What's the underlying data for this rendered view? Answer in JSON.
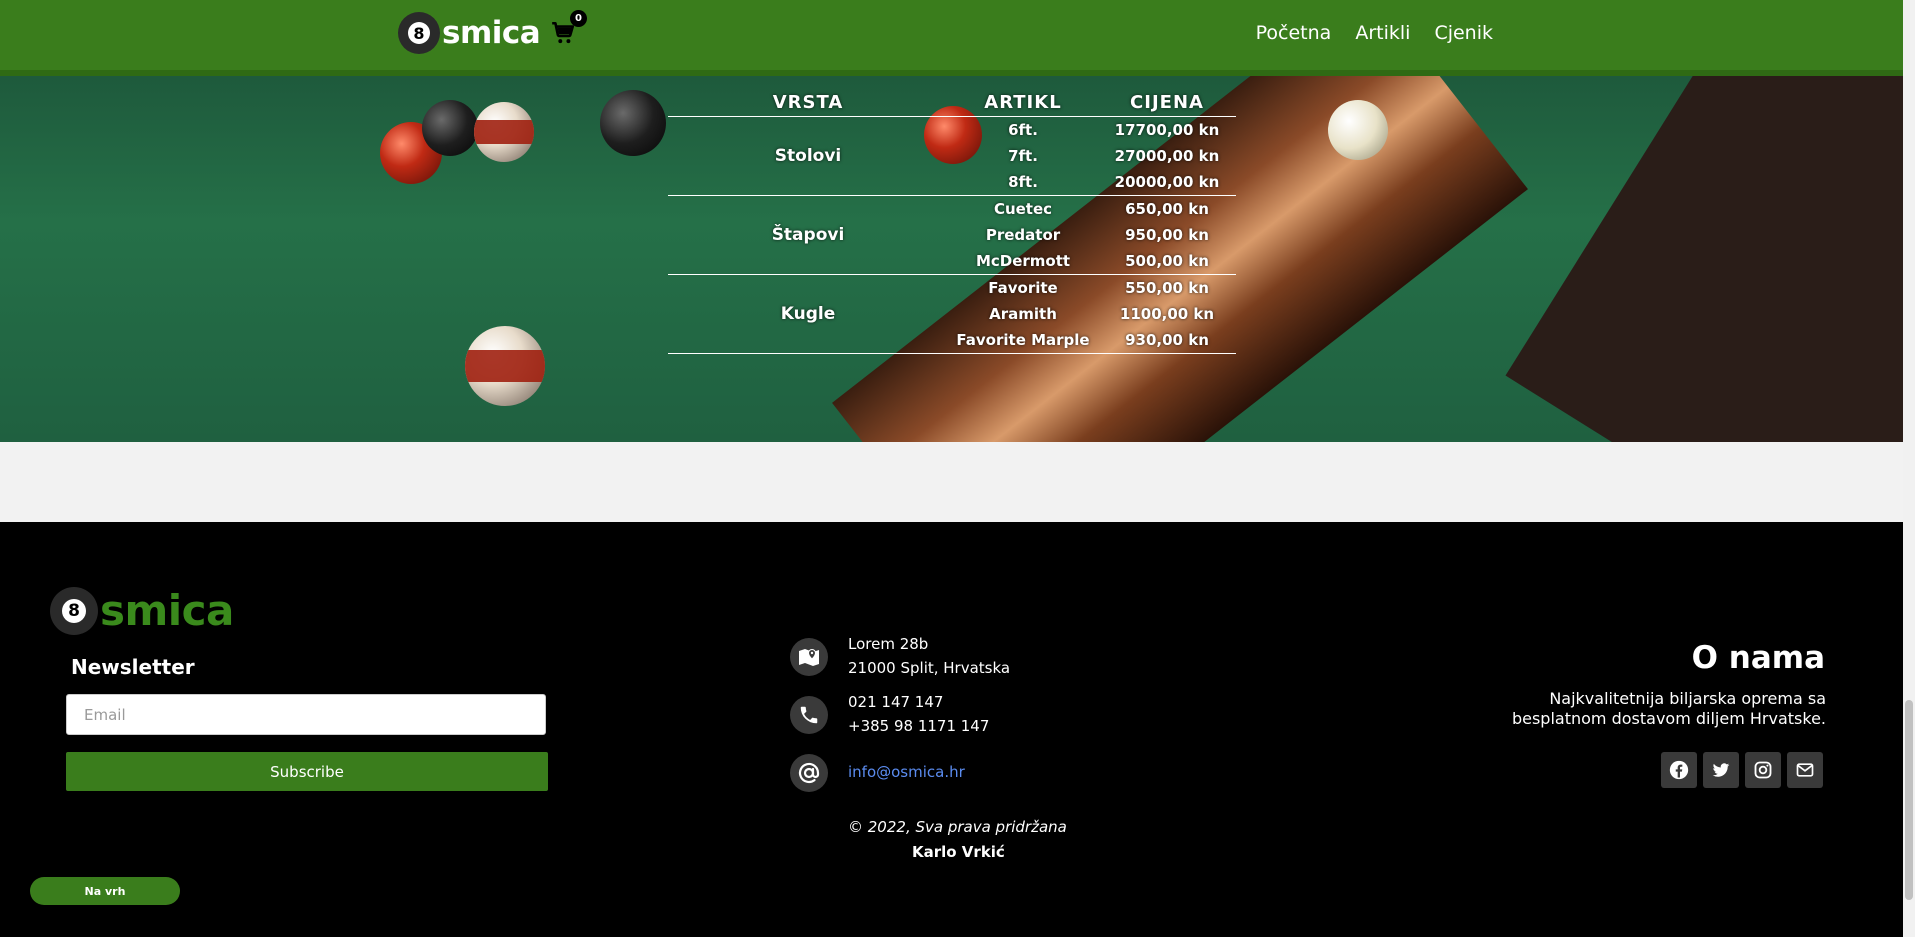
{
  "brand": {
    "logo_digit": "8",
    "logo_text": "smica"
  },
  "cart": {
    "count": "0"
  },
  "nav": {
    "items": [
      "Početna",
      "Artikli",
      "Cjenik"
    ]
  },
  "price_table": {
    "headers": {
      "vrsta": "VRSTA",
      "artikl": "ARTIKL",
      "cijena": "CIJENA"
    },
    "groups": [
      {
        "vrsta": "Stolovi",
        "rows": [
          {
            "artikl": "6ft.",
            "cijena": "17700,00 kn"
          },
          {
            "artikl": "7ft.",
            "cijena": "27000,00 kn"
          },
          {
            "artikl": "8ft.",
            "cijena": "20000,00 kn"
          }
        ]
      },
      {
        "vrsta": "Štapovi",
        "rows": [
          {
            "artikl": "Cuetec",
            "cijena": "650,00 kn"
          },
          {
            "artikl": "Predator",
            "cijena": "950,00 kn"
          },
          {
            "artikl": "McDermott",
            "cijena": "500,00 kn"
          }
        ]
      },
      {
        "vrsta": "Kugle",
        "rows": [
          {
            "artikl": "Favorite",
            "cijena": "550,00 kn"
          },
          {
            "artikl": "Aramith",
            "cijena": "1100,00 kn"
          },
          {
            "artikl": "Favorite Marple",
            "cijena": "930,00 kn"
          }
        ]
      }
    ]
  },
  "footer": {
    "newsletter": {
      "title": "Newsletter",
      "email_placeholder": "Email",
      "subscribe_label": "Subscribe"
    },
    "back_to_top_label": "Na vrh",
    "contact": {
      "address_line1": "Lorem 28b",
      "address_line2": "21000 Split, Hrvatska",
      "phone1": "021 147 147",
      "phone2": "+385 98 1171 147",
      "email": "info@osmica.hr"
    },
    "copyright": "© 2022, Sva prava pridržana",
    "author": "Karlo Vrkić",
    "about": {
      "title": "O nama",
      "text": "Najkvalitetnija biljarska oprema sa besplatnom dostavom diljem Hrvatske."
    },
    "socials": [
      "facebook-icon",
      "twitter-icon",
      "instagram-icon",
      "envelope-icon"
    ]
  },
  "colors": {
    "brand_green": "#3a7d1c",
    "footer_bg": "#000000",
    "link": "#5b8cf0"
  }
}
